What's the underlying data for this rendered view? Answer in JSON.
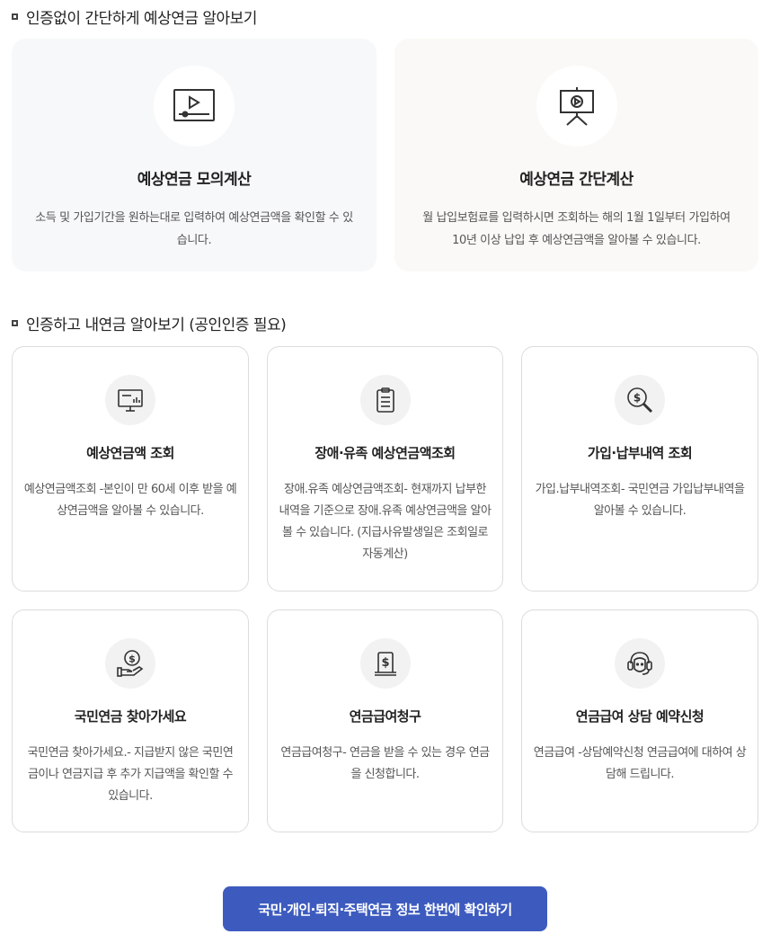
{
  "section1": {
    "title": "인증없이 간단하게 예상연금 알아보기",
    "cards": [
      {
        "icon": "video-player-icon",
        "title": "예상연금 모의계산",
        "desc": "소득 및 가입기간을 원하는대로 입력하여 예상연금액을 확인할 수 있습니다."
      },
      {
        "icon": "presentation-icon",
        "title": "예상연금 간단계산",
        "desc": "월 납입보험료를 입력하시면 조회하는 해의 1월 1일부터 가입하여 10년 이상 납입 후 예상연금액을 알아볼 수 있습니다."
      }
    ]
  },
  "section2": {
    "title": "인증하고 내연금 알아보기 (공인인증 필요)",
    "cards": [
      {
        "icon": "monitor-chart-icon",
        "title": "예상연금액 조회",
        "desc": "예상연금액조회 -본인이 만 60세 이후 받을 예상연금액을 알아볼 수 있습니다."
      },
      {
        "icon": "clipboard-icon",
        "title": "장애·유족 예상연금액조회",
        "desc": "장애.유족 예상연금액조회- 현재까지 납부한 내역을 기준으로 장애.유족 예상연금액을 알아볼 수 있습니다. (지급사유발생일은 조회일로 자동계산)"
      },
      {
        "icon": "dollar-search-icon",
        "title": "가입·납부내역 조회",
        "desc": "가입.납부내역조회- 국민연금 가입납부내역을 알아볼 수 있습니다."
      },
      {
        "icon": "dollar-hand-icon",
        "title": "국민연금 찾아가세요",
        "desc": "국민연금 찾아가세요.- 지급받지 않은 국민연금이나 연금지급 후 추가 지급액을 확인할 수 있습니다."
      },
      {
        "icon": "dollar-document-icon",
        "title": "연금급여청구",
        "desc": "연금급여청구- 연금을 받을 수 있는 경우 연금을 신청합니다."
      },
      {
        "icon": "headset-icon",
        "title": "연금급여 상담 예약신청",
        "desc": "연금급여 -상담예약신청 연금급여에 대하여 상담해 드립니다."
      }
    ]
  },
  "cta": {
    "label": "국민·개인·퇴직·주택연금 정보 한번에 확인하기"
  },
  "colors": {
    "accent": "#3d5bbf",
    "icon_stroke": "#333333"
  }
}
